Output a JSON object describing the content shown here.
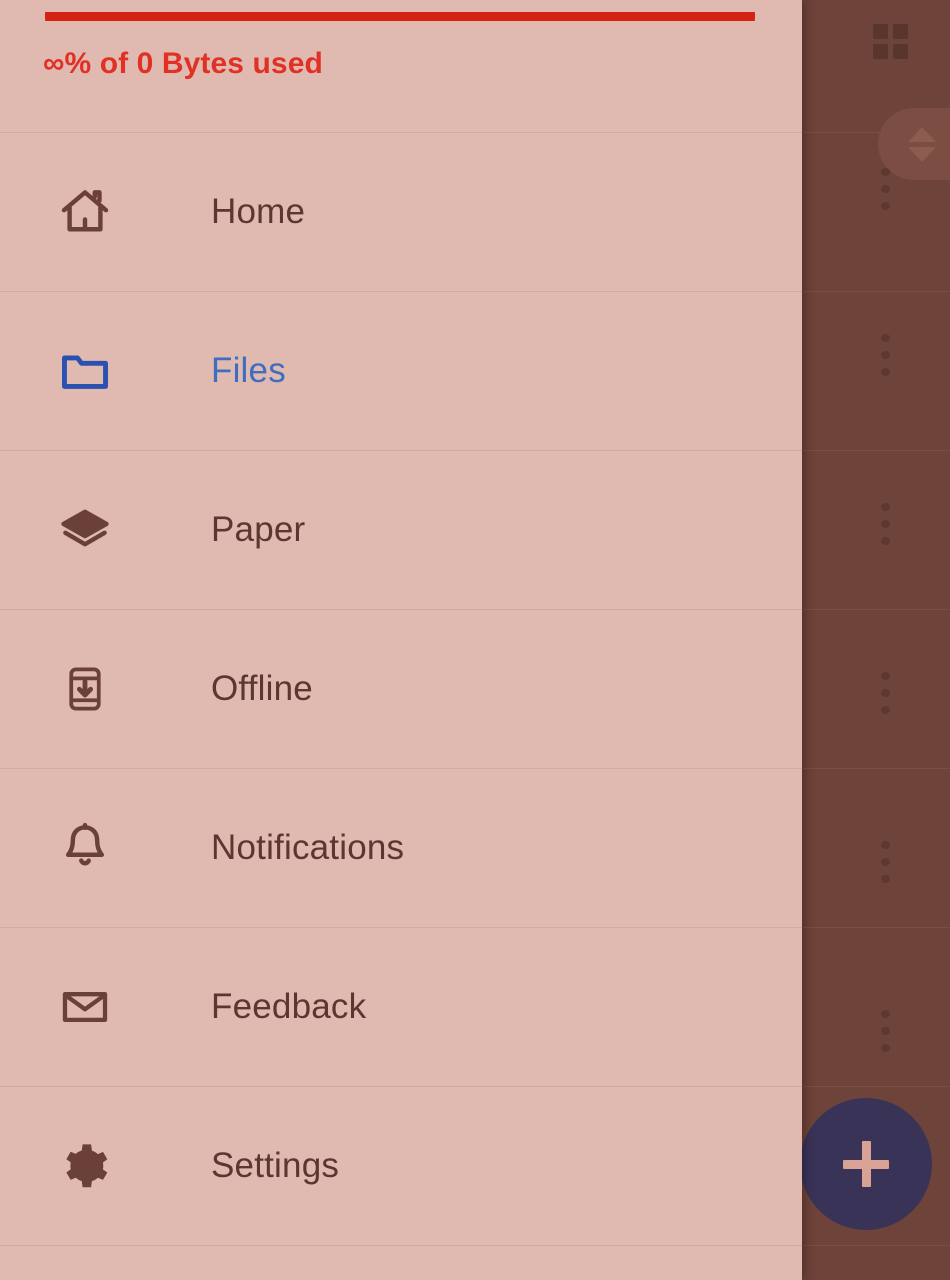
{
  "app": {
    "screen_name": "Navigation drawer"
  },
  "drawer": {
    "storage": {
      "label": "∞% of 0 Bytes used",
      "percent_text": "∞%",
      "used_text": "0 Bytes",
      "fill_percent": 100,
      "bar_color": "#d32211",
      "text_color": "#e03124"
    },
    "items": [
      {
        "label": "Home",
        "icon": "home-icon",
        "selected": false,
        "color": "#5a3730"
      },
      {
        "label": "Files",
        "icon": "folder-icon",
        "selected": true,
        "color": "#3f6ec0"
      },
      {
        "label": "Paper",
        "icon": "layers-icon",
        "selected": false,
        "color": "#5a3730"
      },
      {
        "label": "Offline",
        "icon": "device-download-icon",
        "selected": false,
        "color": "#5a3730"
      },
      {
        "label": "Notifications",
        "icon": "bell-icon",
        "selected": false,
        "color": "#5a3730"
      },
      {
        "label": "Feedback",
        "icon": "envelope-icon",
        "selected": false,
        "color": "#5a3730"
      },
      {
        "label": "Settings",
        "icon": "gear-icon",
        "selected": false,
        "color": "#5a3730"
      }
    ],
    "background_color": "#e0b9b1"
  },
  "background": {
    "scrim_color": "#6e4339",
    "grid_view_icon": "grid-view-icon",
    "sort_chip_icon": "sort-arrows-icon",
    "fab": {
      "icon": "plus-icon",
      "color": "#3a3358",
      "glyph_color": "#d8a394"
    },
    "overflow_menu_icon": "more-vertical-icon",
    "overflow_menu_count": 6,
    "row_count": 6
  }
}
